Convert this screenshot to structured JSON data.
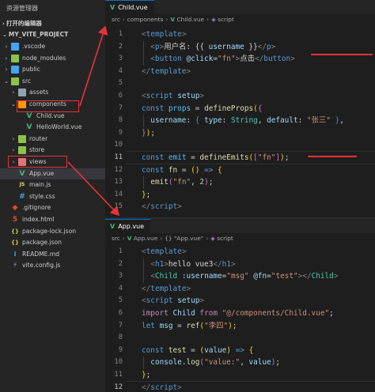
{
  "explorer": {
    "title": "资源管理器",
    "open_editors": "打开的编辑器",
    "project": "MY_VITE_PROJECT",
    "items": [
      {
        "name": "vscode_folder",
        "label": ".vscode",
        "depth": 1,
        "kind": "folder",
        "color": "blue",
        "expanded": false
      },
      {
        "name": "node_modules_folder",
        "label": "node_modules",
        "depth": 1,
        "kind": "folder",
        "color": "green",
        "expanded": false
      },
      {
        "name": "public_folder",
        "label": "public",
        "depth": 1,
        "kind": "folder",
        "color": "blue",
        "expanded": false
      },
      {
        "name": "src_folder",
        "label": "src",
        "depth": 1,
        "kind": "folder",
        "color": "green",
        "expanded": true
      },
      {
        "name": "assets_folder",
        "label": "assets",
        "depth": 2,
        "kind": "folder",
        "color": "grey",
        "expanded": false
      },
      {
        "name": "components_folder",
        "label": "components",
        "depth": 2,
        "kind": "folder",
        "color": "orange",
        "expanded": true
      },
      {
        "name": "child_vue_file",
        "label": "Child.vue",
        "depth": 3,
        "kind": "vue"
      },
      {
        "name": "helloworld_vue_file",
        "label": "HelloWorld.vue",
        "depth": 3,
        "kind": "vue"
      },
      {
        "name": "router_folder",
        "label": "router",
        "depth": 2,
        "kind": "folder",
        "color": "green",
        "expanded": false
      },
      {
        "name": "store_folder",
        "label": "store",
        "depth": 2,
        "kind": "folder",
        "color": "green",
        "expanded": false
      },
      {
        "name": "views_folder",
        "label": "views",
        "depth": 2,
        "kind": "folder",
        "color": "red",
        "expanded": false
      },
      {
        "name": "app_vue_file",
        "label": "App.vue",
        "depth": 2,
        "kind": "vue",
        "selected": true
      },
      {
        "name": "main_js_file",
        "label": "main.js",
        "depth": 2,
        "kind": "js"
      },
      {
        "name": "style_css_file",
        "label": "style.css",
        "depth": 2,
        "kind": "css"
      },
      {
        "name": "gitignore_file",
        "label": ".gitignore",
        "depth": 1,
        "kind": "git"
      },
      {
        "name": "index_html_file",
        "label": "index.html",
        "depth": 1,
        "kind": "html"
      },
      {
        "name": "package_lock_file",
        "label": "package-lock.json",
        "depth": 1,
        "kind": "json"
      },
      {
        "name": "package_json_file",
        "label": "package.json",
        "depth": 1,
        "kind": "json"
      },
      {
        "name": "readme_file",
        "label": "README.md",
        "depth": 1,
        "kind": "md"
      },
      {
        "name": "vite_config_file",
        "label": "vite.config.js",
        "depth": 1,
        "kind": "vite"
      }
    ]
  },
  "child_editor": {
    "tab": "Child.vue",
    "breadcrumb": {
      "a": "src",
      "b": "components",
      "c": "Child.vue",
      "d": "script"
    },
    "active_line": 11,
    "lines": [
      [
        [
          "t-br",
          "<"
        ],
        [
          "t-tag",
          "template"
        ],
        [
          "t-br",
          ">"
        ]
      ],
      [
        [
          "t-txt",
          "  "
        ],
        [
          "t-br",
          "<"
        ],
        [
          "t-tag",
          "p"
        ],
        [
          "t-br",
          ">"
        ],
        [
          "t-txt",
          "用户名: "
        ],
        [
          "t-txt",
          "{{ "
        ],
        [
          "t-var",
          "username"
        ],
        [
          "t-txt",
          " }}"
        ],
        [
          "t-br",
          "</"
        ],
        [
          "t-tag",
          "p"
        ],
        [
          "t-br",
          ">"
        ]
      ],
      [
        [
          "t-txt",
          "  "
        ],
        [
          "t-br",
          "<"
        ],
        [
          "t-tag",
          "button"
        ],
        [
          "t-txt",
          " "
        ],
        [
          "t-attr",
          "@click"
        ],
        [
          "t-txt",
          "="
        ],
        [
          "t-str",
          "\"fn\""
        ],
        [
          "t-br",
          ">"
        ],
        [
          "t-txt",
          "点击"
        ],
        [
          "t-br",
          "</"
        ],
        [
          "t-tag",
          "button"
        ],
        [
          "t-br",
          ">"
        ]
      ],
      [
        [
          "t-br",
          "</"
        ],
        [
          "t-tag",
          "template"
        ],
        [
          "t-br",
          ">"
        ]
      ],
      [],
      [
        [
          "t-br",
          "<"
        ],
        [
          "t-tag",
          "script"
        ],
        [
          "t-txt",
          " "
        ],
        [
          "t-attr",
          "setup"
        ],
        [
          "t-br",
          ">"
        ]
      ],
      [
        [
          "t-kw",
          "const"
        ],
        [
          "t-txt",
          " "
        ],
        [
          "t-const",
          "props"
        ],
        [
          "t-txt",
          " = "
        ],
        [
          "t-fn",
          "defineProps"
        ],
        [
          "t-y",
          "("
        ],
        [
          "t-p",
          "{"
        ]
      ],
      [
        [
          "t-txt",
          "  "
        ],
        [
          "t-var",
          "username"
        ],
        [
          "t-txt",
          ": "
        ],
        [
          "t-b",
          "{"
        ],
        [
          "t-txt",
          " "
        ],
        [
          "t-var",
          "type"
        ],
        [
          "t-txt",
          ": "
        ],
        [
          "t-cls",
          "String"
        ],
        [
          "t-txt",
          ", "
        ],
        [
          "t-var",
          "default"
        ],
        [
          "t-txt",
          ": "
        ],
        [
          "t-str",
          "\"张三\""
        ],
        [
          "t-txt",
          " "
        ],
        [
          "t-b",
          "}"
        ],
        [
          "t-txt",
          ","
        ]
      ],
      [
        [
          "t-p",
          "}"
        ],
        [
          "t-y",
          ")"
        ],
        [
          "t-txt",
          ";"
        ]
      ],
      [],
      [
        [
          "t-kw",
          "const"
        ],
        [
          "t-txt",
          " "
        ],
        [
          "t-const",
          "emit"
        ],
        [
          "t-txt",
          " = "
        ],
        [
          "t-fn",
          "defineEmits"
        ],
        [
          "t-y",
          "("
        ],
        [
          "t-p",
          "["
        ],
        [
          "t-str",
          "\"fn\""
        ],
        [
          "t-p",
          "]"
        ],
        [
          "t-y",
          ")"
        ],
        [
          "t-txt",
          ";"
        ]
      ],
      [
        [
          "t-kw",
          "const"
        ],
        [
          "t-txt",
          " "
        ],
        [
          "t-fn",
          "fn"
        ],
        [
          "t-txt",
          " = "
        ],
        [
          "t-y",
          "()"
        ],
        [
          "t-txt",
          " "
        ],
        [
          "t-kw",
          "=>"
        ],
        [
          "t-txt",
          " "
        ],
        [
          "t-y",
          "{"
        ]
      ],
      [
        [
          "t-txt",
          "  "
        ],
        [
          "t-fn",
          "emit"
        ],
        [
          "t-p",
          "("
        ],
        [
          "t-str",
          "\"fn\""
        ],
        [
          "t-txt",
          ", "
        ],
        [
          "t-num",
          "2"
        ],
        [
          "t-p",
          ")"
        ],
        [
          "t-txt",
          ";"
        ]
      ],
      [
        [
          "t-y",
          "}"
        ],
        [
          "t-txt",
          ";"
        ]
      ],
      [
        [
          "t-br",
          "</"
        ],
        [
          "t-tag",
          "script"
        ],
        [
          "t-br",
          ">"
        ]
      ]
    ]
  },
  "app_editor": {
    "tab": "App.vue",
    "breadcrumb": {
      "a": "src",
      "b": "App.vue",
      "c": "{} \"App.vue\"",
      "d": "script"
    },
    "active_line": 12,
    "lines": [
      [
        [
          "t-br",
          "<"
        ],
        [
          "t-tag",
          "template"
        ],
        [
          "t-br",
          ">"
        ]
      ],
      [
        [
          "t-txt",
          "  "
        ],
        [
          "t-br",
          "<"
        ],
        [
          "t-tag",
          "h1"
        ],
        [
          "t-br",
          ">"
        ],
        [
          "t-txt",
          "hello vue3"
        ],
        [
          "t-br",
          "</"
        ],
        [
          "t-tag",
          "h1"
        ],
        [
          "t-br",
          ">"
        ]
      ],
      [
        [
          "t-txt",
          "  "
        ],
        [
          "t-br",
          "<"
        ],
        [
          "t-cls",
          "Child"
        ],
        [
          "t-txt",
          " "
        ],
        [
          "t-attr",
          ":username"
        ],
        [
          "t-txt",
          "="
        ],
        [
          "t-str",
          "\"msg\""
        ],
        [
          "t-txt",
          " "
        ],
        [
          "t-attr",
          "@fn"
        ],
        [
          "t-txt",
          "="
        ],
        [
          "t-str",
          "\"test\""
        ],
        [
          "t-br",
          "></"
        ],
        [
          "t-cls",
          "Child"
        ],
        [
          "t-br",
          ">"
        ]
      ],
      [
        [
          "t-br",
          "</"
        ],
        [
          "t-tag",
          "template"
        ],
        [
          "t-br",
          ">"
        ]
      ],
      [
        [
          "t-br",
          "<"
        ],
        [
          "t-tag",
          "script"
        ],
        [
          "t-txt",
          " "
        ],
        [
          "t-attr",
          "setup"
        ],
        [
          "t-br",
          ">"
        ]
      ],
      [
        [
          "t-imp",
          "import"
        ],
        [
          "t-txt",
          " "
        ],
        [
          "t-var",
          "Child"
        ],
        [
          "t-txt",
          " "
        ],
        [
          "t-imp",
          "from"
        ],
        [
          "t-txt",
          " "
        ],
        [
          "t-str",
          "\"@/components/Child.vue\""
        ],
        [
          "t-txt",
          ";"
        ]
      ],
      [
        [
          "t-kw",
          "let"
        ],
        [
          "t-txt",
          " "
        ],
        [
          "t-var",
          "msg"
        ],
        [
          "t-txt",
          " = "
        ],
        [
          "t-fn",
          "ref"
        ],
        [
          "t-y",
          "("
        ],
        [
          "t-str",
          "\"李四\""
        ],
        [
          "t-y",
          ")"
        ],
        [
          "t-txt",
          ";"
        ]
      ],
      [],
      [
        [
          "t-kw",
          "const"
        ],
        [
          "t-txt",
          " "
        ],
        [
          "t-fn",
          "test"
        ],
        [
          "t-txt",
          " = "
        ],
        [
          "t-y",
          "("
        ],
        [
          "t-var",
          "value"
        ],
        [
          "t-y",
          ")"
        ],
        [
          "t-txt",
          " "
        ],
        [
          "t-kw",
          "=>"
        ],
        [
          "t-txt",
          " "
        ],
        [
          "t-y",
          "{"
        ]
      ],
      [
        [
          "t-txt",
          "  "
        ],
        [
          "t-var",
          "console"
        ],
        [
          "t-txt",
          "."
        ],
        [
          "t-fn",
          "log"
        ],
        [
          "t-p",
          "("
        ],
        [
          "t-str",
          "\"value:\""
        ],
        [
          "t-txt",
          ", "
        ],
        [
          "t-var",
          "value"
        ],
        [
          "t-p",
          ")"
        ],
        [
          "t-txt",
          ";"
        ]
      ],
      [
        [
          "t-y",
          "}"
        ],
        [
          "t-txt",
          ";"
        ]
      ],
      [
        [
          "t-br",
          "</"
        ],
        [
          "t-tag",
          "script"
        ],
        [
          "t-br",
          ">"
        ]
      ]
    ]
  }
}
